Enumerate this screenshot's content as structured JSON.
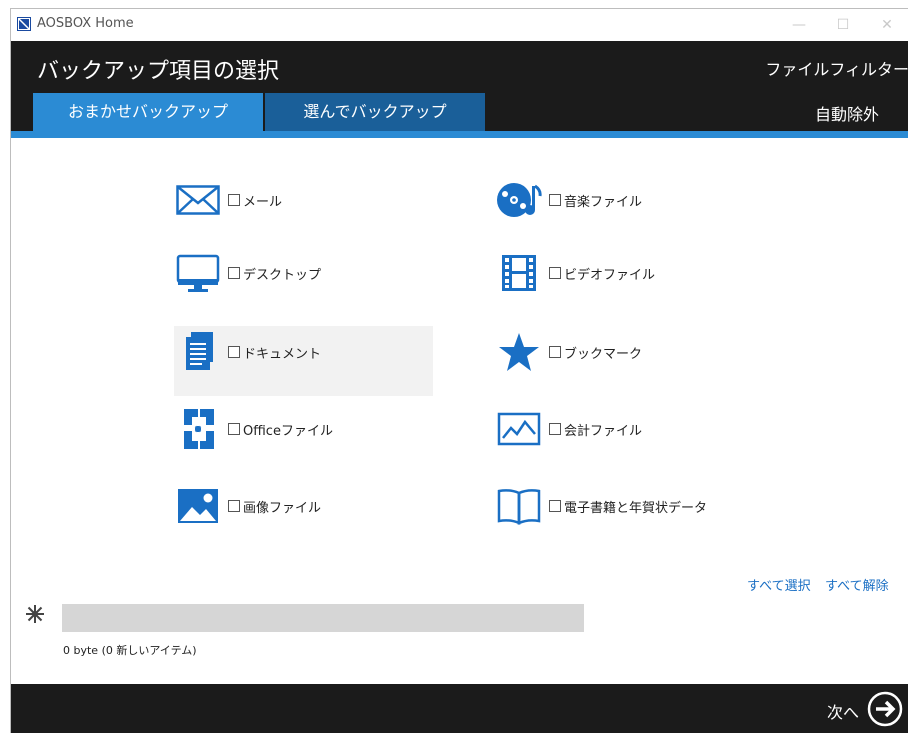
{
  "window": {
    "title": "AOSBOX Home",
    "minimize": "—",
    "maximize": "☐",
    "close": "✕"
  },
  "header": {
    "title": "バックアップ項目の選択",
    "file_filter_link": "ファイルフィルター",
    "auto_exclude_link": "自動除外",
    "tabs": [
      {
        "label": "おまかせバックアップ",
        "active": true
      },
      {
        "label": "選んでバックアップ",
        "active": false
      }
    ]
  },
  "items": [
    {
      "label": "メール",
      "icon": "mail-icon",
      "checked": false
    },
    {
      "label": "デスクトップ",
      "icon": "monitor-icon",
      "checked": false
    },
    {
      "label": "ドキュメント",
      "icon": "document-icon",
      "checked": false
    },
    {
      "label": "Officeファイル",
      "icon": "office-icon",
      "checked": false
    },
    {
      "label": "画像ファイル",
      "icon": "picture-icon",
      "checked": false
    },
    {
      "label": "音楽ファイル",
      "icon": "music-icon",
      "checked": false
    },
    {
      "label": "ビデオファイル",
      "icon": "film-icon",
      "checked": false
    },
    {
      "label": "ブックマーク",
      "icon": "star-icon",
      "checked": false
    },
    {
      "label": "会計ファイル",
      "icon": "chart-icon",
      "checked": false
    },
    {
      "label": "電子書籍と年賀状データ",
      "icon": "book-icon",
      "checked": false
    }
  ],
  "select_all": "すべて選択",
  "deselect_all": "すべて解除",
  "progress": {
    "fraction": 0,
    "size_text": "0 byte (0 新しいアイテム)"
  },
  "footer": {
    "next_label": "次へ"
  },
  "colors": {
    "accent": "#2b8bd4",
    "tab_inactive": "#1a5f99",
    "header_bg": "#1b1b1b",
    "icon_blue": "#1a6fc4"
  }
}
